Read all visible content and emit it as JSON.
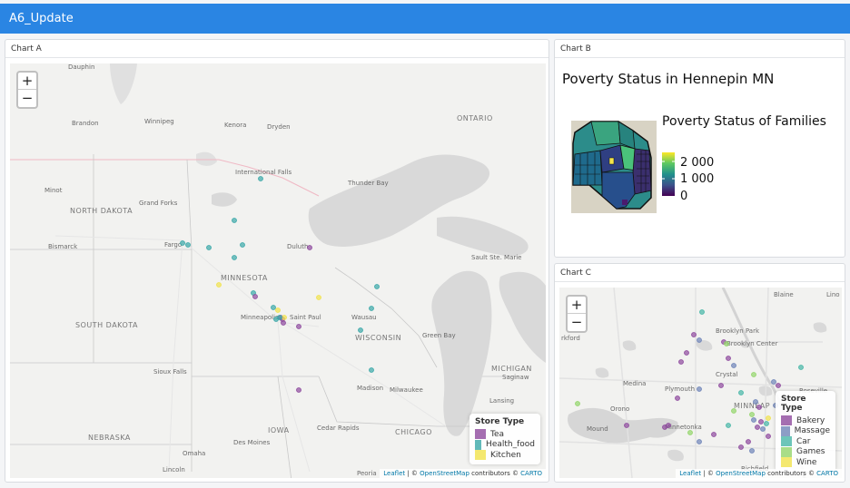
{
  "navbar": {
    "title": "A6_Update"
  },
  "chart_a": {
    "header": "Chart A",
    "zoom_in": "+",
    "zoom_out": "−",
    "places": [
      {
        "name": "Dauphin"
      },
      {
        "name": "Brandon"
      },
      {
        "name": "Winnipeg"
      },
      {
        "name": "Kenora"
      },
      {
        "name": "Dryden"
      },
      {
        "name": "ONTARIO"
      },
      {
        "name": "International Falls"
      },
      {
        "name": "Thunder Bay"
      },
      {
        "name": "Minot"
      },
      {
        "name": "NORTH DAKOTA"
      },
      {
        "name": "Grand Forks"
      },
      {
        "name": "Bismarck"
      },
      {
        "name": "Fargo"
      },
      {
        "name": "Duluth"
      },
      {
        "name": "Sault Ste. Marie"
      },
      {
        "name": "MINNESOTA"
      },
      {
        "name": "SOUTH DAKOTA"
      },
      {
        "name": "Minneapolis"
      },
      {
        "name": "Saint Paul"
      },
      {
        "name": "Wausau"
      },
      {
        "name": "WISCONSIN"
      },
      {
        "name": "Green Bay"
      },
      {
        "name": "Sioux Falls"
      },
      {
        "name": "MICHIGAN"
      },
      {
        "name": "Saginaw"
      },
      {
        "name": "Madison"
      },
      {
        "name": "Milwaukee"
      },
      {
        "name": "Lansing"
      },
      {
        "name": "IOWA"
      },
      {
        "name": "Cedar Rapids"
      },
      {
        "name": "NEBRASKA"
      },
      {
        "name": "Des Moines"
      },
      {
        "name": "CHICAGO"
      },
      {
        "name": "Omaha"
      },
      {
        "name": "Lincoln"
      },
      {
        "name": "Peoria"
      }
    ],
    "legend": {
      "title": "Store Type",
      "items": [
        {
          "label": "Tea",
          "color": "#8e4a9e"
        },
        {
          "label": "Health_food",
          "color": "#3aa8a8"
        },
        {
          "label": "Kitchen",
          "color": "#f1e24b"
        }
      ]
    },
    "attribution": {
      "leaflet": "Leaflet",
      "sep": " | © ",
      "osm": "OpenStreetMap",
      "contrib": " contributors © ",
      "carto": "CARTO"
    }
  },
  "chart_b": {
    "header": "Chart B",
    "title": "Poverty Status in Hennepin MN",
    "colorbar_title": "Poverty Status of Families",
    "ticks": [
      "2 000",
      "1 000",
      "0"
    ]
  },
  "chart_c": {
    "header": "Chart C",
    "zoom_in": "+",
    "zoom_out": "−",
    "places": [
      {
        "name": "Blaine"
      },
      {
        "name": "Lino"
      },
      {
        "name": "Brooklyn Park"
      },
      {
        "name": "Brooklyn Center"
      },
      {
        "name": "rkford"
      },
      {
        "name": "Crystal"
      },
      {
        "name": "Medina"
      },
      {
        "name": "Plymouth"
      },
      {
        "name": "Orono"
      },
      {
        "name": "MINNEAP"
      },
      {
        "name": "Minnetonka"
      },
      {
        "name": "Mound"
      },
      {
        "name": "Roseville"
      },
      {
        "name": "Richfield"
      }
    ],
    "legend": {
      "title": "Store Type",
      "items": [
        {
          "label": "Bakery",
          "color": "#8e4a9e"
        },
        {
          "label": "Massage",
          "color": "#6f84b8"
        },
        {
          "label": "Car",
          "color": "#47b7a7"
        },
        {
          "label": "Games",
          "color": "#93d56a"
        },
        {
          "label": "Wine",
          "color": "#f1e24b"
        }
      ]
    },
    "attribution": {
      "leaflet": "Leaflet",
      "sep": " | © ",
      "osm": "OpenStreetMap",
      "contrib": " contributors © ",
      "carto": "CARTO"
    }
  }
}
